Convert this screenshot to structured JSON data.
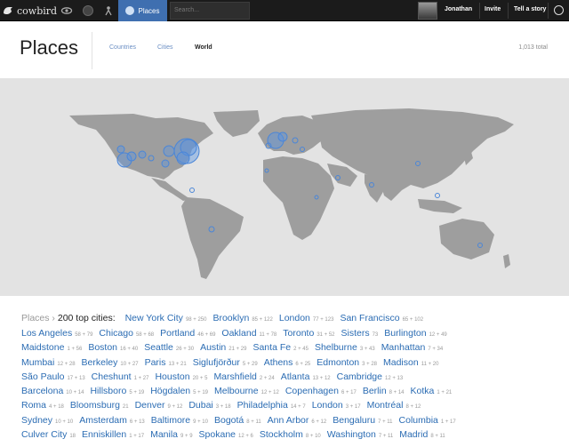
{
  "topbar": {
    "brand": "cowbird",
    "places_tab": "Places",
    "search_placeholder": "Search...",
    "user_name": "Jonathan",
    "invite": "Invite",
    "tell_story": "Tell a story"
  },
  "header": {
    "title": "Places",
    "tabs": [
      {
        "label": "Countries"
      },
      {
        "label": "Cities"
      },
      {
        "label": "World"
      }
    ],
    "total": "1,013 total"
  },
  "list": {
    "breadcrumb": "Places ›",
    "count_label": "200 top cities:",
    "lines": [
      [
        {
          "name": "New York City",
          "stats": "98 + 250"
        },
        {
          "name": "Brooklyn",
          "stats": "85 + 122"
        },
        {
          "name": "London",
          "stats": "77 + 123"
        },
        {
          "name": "San Francisco",
          "stats": "65 + 102"
        }
      ],
      [
        {
          "name": "Los Angeles",
          "stats": "58 + 79"
        },
        {
          "name": "Chicago",
          "stats": "58 + 68"
        },
        {
          "name": "Portland",
          "stats": "46 + 69"
        },
        {
          "name": "Oakland",
          "stats": "11 + 78"
        },
        {
          "name": "Toronto",
          "stats": "31 + 52"
        },
        {
          "name": "Sisters",
          "stats": "73"
        },
        {
          "name": "Burlington",
          "stats": "12 + 49"
        }
      ],
      [
        {
          "name": "Maidstone",
          "stats": "1 + 56"
        },
        {
          "name": "Boston",
          "stats": "16 + 40"
        },
        {
          "name": "Seattle",
          "stats": "26 + 30"
        },
        {
          "name": "Austin",
          "stats": "21 + 29"
        },
        {
          "name": "Santa Fe",
          "stats": "2 + 45"
        },
        {
          "name": "Shelburne",
          "stats": "3 + 43"
        },
        {
          "name": "Manhattan",
          "stats": "7 + 34"
        }
      ],
      [
        {
          "name": "Mumbai",
          "stats": "12 + 28"
        },
        {
          "name": "Berkeley",
          "stats": "10 + 27"
        },
        {
          "name": "Paris",
          "stats": "13 + 21"
        },
        {
          "name": "Siglufjörður",
          "stats": "5 + 29"
        },
        {
          "name": "Athens",
          "stats": "6 + 25"
        },
        {
          "name": "Edmonton",
          "stats": "3 + 28"
        },
        {
          "name": "Madison",
          "stats": "11 + 20"
        }
      ],
      [
        {
          "name": "São Paulo",
          "stats": "17 + 13"
        },
        {
          "name": "Cheshunt",
          "stats": "1 + 27"
        },
        {
          "name": "Houston",
          "stats": "20 + 5"
        },
        {
          "name": "Marshfield",
          "stats": "2 + 24"
        },
        {
          "name": "Atlanta",
          "stats": "13 + 12"
        },
        {
          "name": "Cambridge",
          "stats": "12 + 13"
        }
      ],
      [
        {
          "name": "Barcelona",
          "stats": "10 + 14"
        },
        {
          "name": "Hillsboro",
          "stats": "5 + 19"
        },
        {
          "name": "Högdalen",
          "stats": "5 + 19"
        },
        {
          "name": "Melbourne",
          "stats": "12 + 12"
        },
        {
          "name": "Copenhagen",
          "stats": "6 + 17"
        },
        {
          "name": "Berlin",
          "stats": "8 + 14"
        },
        {
          "name": "Kotka",
          "stats": "1 + 21"
        }
      ],
      [
        {
          "name": "Roma",
          "stats": "4 + 18"
        },
        {
          "name": "Bloomsburg",
          "stats": "21"
        },
        {
          "name": "Denver",
          "stats": "9 + 12"
        },
        {
          "name": "Dubai",
          "stats": "3 + 18"
        },
        {
          "name": "Philadelphia",
          "stats": "14 + 7"
        },
        {
          "name": "London",
          "stats": "3 + 17"
        },
        {
          "name": "Montréal",
          "stats": "8 + 12"
        }
      ],
      [
        {
          "name": "Sydney",
          "stats": "10 + 10"
        },
        {
          "name": "Amsterdam",
          "stats": "6 + 13"
        },
        {
          "name": "Baltimore",
          "stats": "9 + 10"
        },
        {
          "name": "Bogotá",
          "stats": "8 + 11"
        },
        {
          "name": "Ann Arbor",
          "stats": "6 + 12"
        },
        {
          "name": "Bengaluru",
          "stats": "7 + 11"
        },
        {
          "name": "Columbia",
          "stats": "1 + 17"
        }
      ],
      [
        {
          "name": "Culver City",
          "stats": "18"
        },
        {
          "name": "Enniskillen",
          "stats": "1 + 17"
        },
        {
          "name": "Manila",
          "stats": "9 + 9"
        },
        {
          "name": "Spokane",
          "stats": "12 + 6"
        },
        {
          "name": "Stockholm",
          "stats": "8 + 10"
        },
        {
          "name": "Washington",
          "stats": "7 + 11"
        },
        {
          "name": "Madrid",
          "stats": "8 + 11"
        }
      ]
    ]
  },
  "colors": {
    "accent": "#3f6fb0",
    "link": "#2b6cb3",
    "land": "#9e9e9e",
    "ocean": "#e3e3e3",
    "marker": "#4a86d8"
  }
}
